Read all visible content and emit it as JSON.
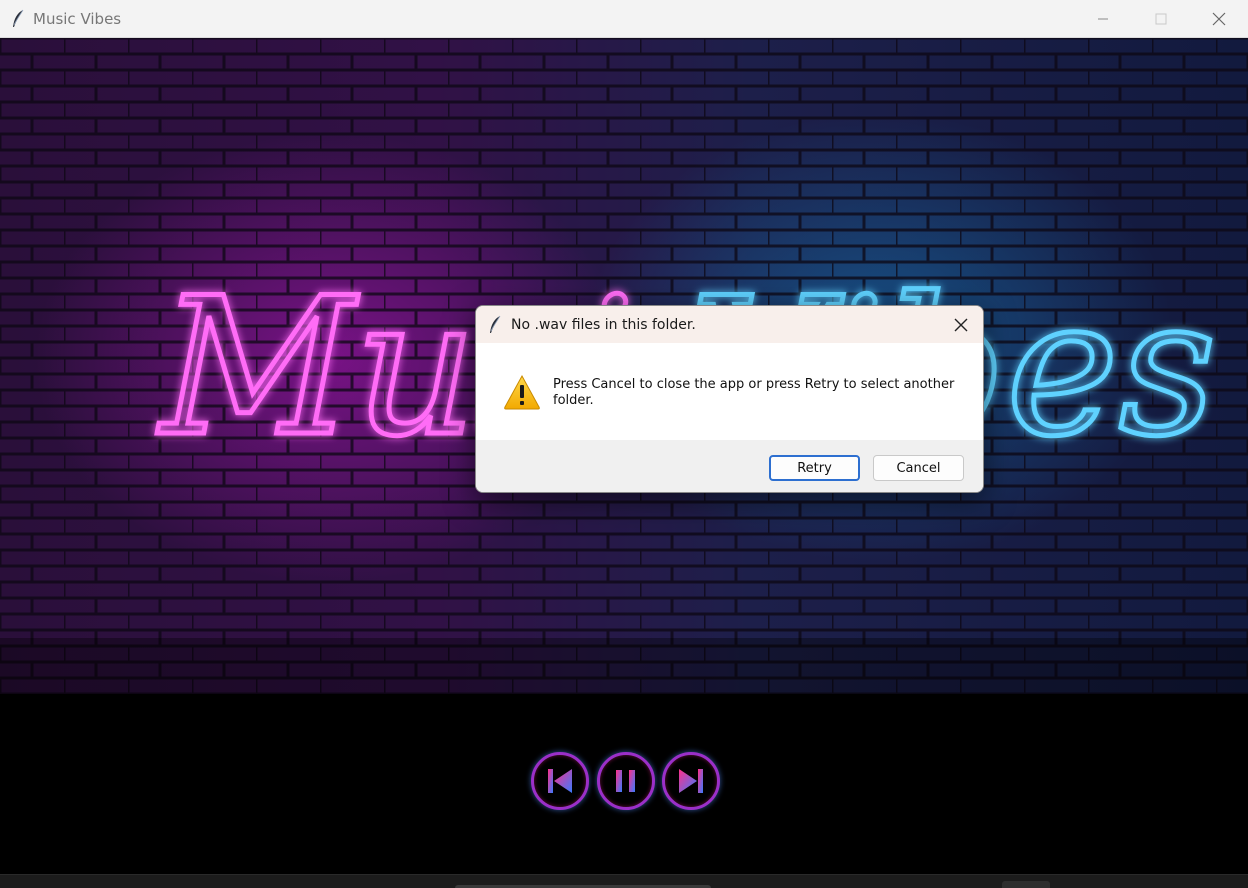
{
  "window": {
    "title": "Music Vibes",
    "app_icon": "feather-icon",
    "controls": [
      "minimize-icon",
      "maximize-icon",
      "close-icon"
    ]
  },
  "banner": {
    "neon_text_left": "Music",
    "neon_text_right": "Vibes",
    "colors": {
      "left_glow": "#ff3df5",
      "right_glow": "#3fc7ff"
    }
  },
  "player": {
    "buttons": [
      {
        "name": "previous",
        "icon": "skip-previous-icon"
      },
      {
        "name": "pause",
        "icon": "pause-icon"
      },
      {
        "name": "next",
        "icon": "skip-next-icon"
      }
    ]
  },
  "dialog": {
    "title": "No .wav files in this folder.",
    "icon": "warning-icon",
    "message": "Press Cancel to close the app or press Retry to select another folder.",
    "retry_label": "Retry",
    "cancel_label": "Cancel",
    "accent": "#2d6fd0"
  }
}
